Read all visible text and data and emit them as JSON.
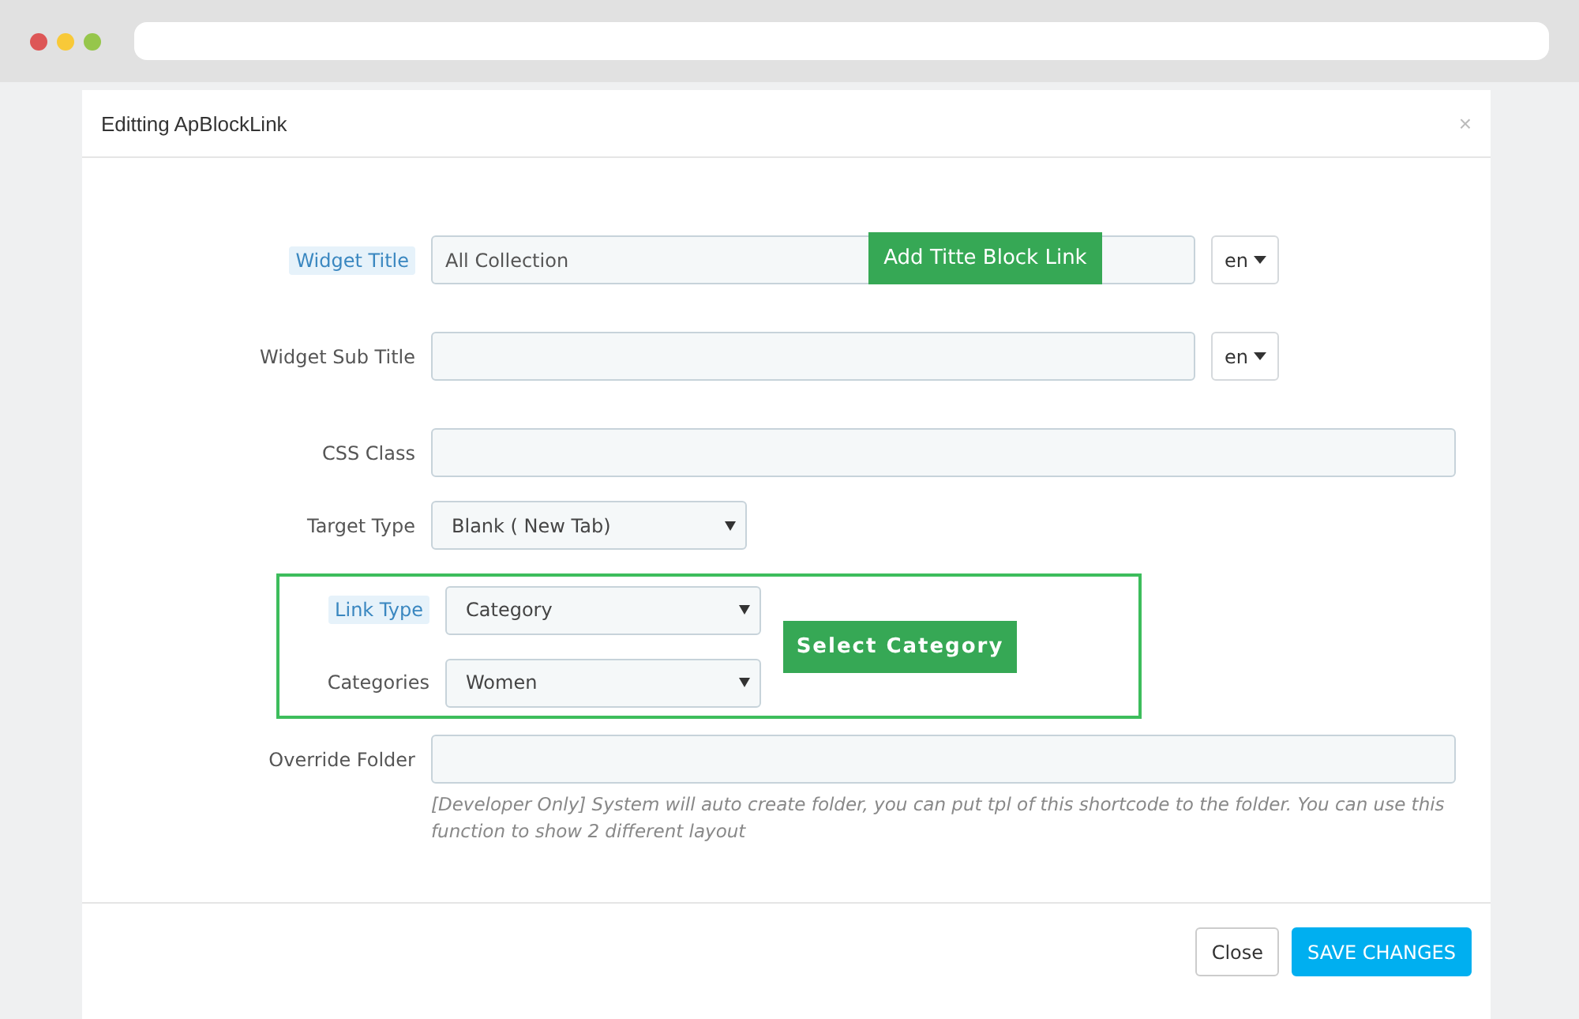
{
  "window": {
    "title": "Editting ApBlockLink",
    "close": "×"
  },
  "fields": [
    {
      "kind": "text-lang",
      "label": "Widget Title",
      "highlighted": true,
      "value": "All Collection",
      "lang": "en",
      "callout": "Add Titte Block Link"
    },
    {
      "kind": "text-lang",
      "label": "Widget Sub Title",
      "highlighted": false,
      "lang": "en"
    },
    {
      "kind": "text",
      "label": "CSS Class",
      "highlighted": false
    },
    {
      "kind": "select",
      "label": "Target Type",
      "highlighted": false,
      "value": "Blank ( New Tab)"
    },
    {
      "kind": "group",
      "callout": "Select Category",
      "children": [
        {
          "kind": "select",
          "label": "Link Type",
          "highlighted": true,
          "value": "Category"
        },
        {
          "kind": "select",
          "label": "Categories",
          "highlighted": false,
          "value": "Women"
        }
      ]
    },
    {
      "kind": "text",
      "label": "Override Folder",
      "highlighted": false,
      "help": "[Developer Only] System will auto create folder, you can put tpl of this shortcode to the folder. You can use this function to show 2 different layout"
    }
  ],
  "buttons": [
    {
      "label": "Close",
      "kind": "default"
    },
    {
      "label": "SAVE CHANGES",
      "kind": "primary"
    }
  ]
}
